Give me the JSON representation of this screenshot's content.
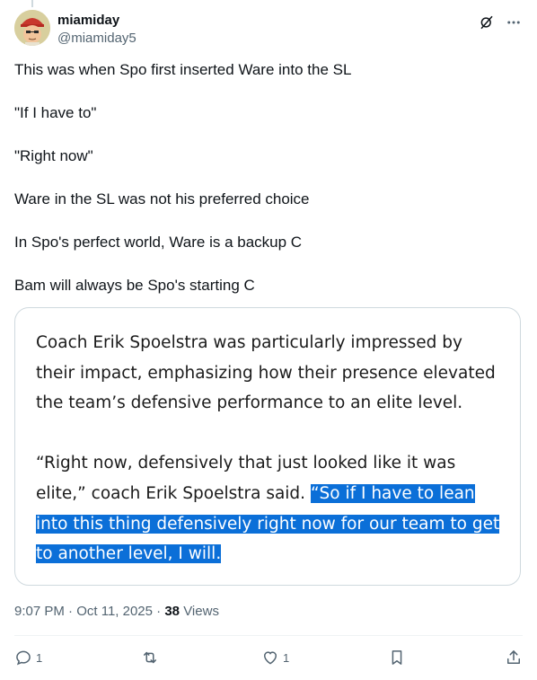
{
  "author": {
    "display_name": "miamiday",
    "handle": "@miamiday5"
  },
  "tweet": {
    "paragraphs": [
      "This was when Spo first inserted Ware into the SL",
      "\"If I have to\"",
      "\"Right now\"",
      "Ware in the SL was not his preferred choice",
      "In Spo's perfect world, Ware is a backup C",
      "Bam will always be Spo's starting C"
    ]
  },
  "quote": {
    "paragraph1": "Coach Erik Spoelstra was particularly impressed by their impact, emphasizing how their presence elevated the team’s defensive performance to an elite level.",
    "paragraph2_plain": "“Right now, defensively that just looked like it was elite,” coach Erik Spoelstra said. ",
    "paragraph2_highlight": "“So if I have to lean into this thing defensively right now for our team to get to another level, I will."
  },
  "meta": {
    "time": "9:07 PM",
    "separator1": " · ",
    "date": "Oct 11, 2025",
    "separator2": " · ",
    "views_count": "38",
    "views_label": " Views"
  },
  "actions": {
    "reply_count": "1",
    "repost_count": "",
    "like_count": "1"
  },
  "icons": {
    "header": [
      "grok-icon",
      "more-icon"
    ],
    "footer": [
      "reply-icon",
      "repost-icon",
      "like-icon",
      "bookmark-icon",
      "share-icon"
    ]
  },
  "colors": {
    "text_primary": "#0f1419",
    "text_secondary": "#536471",
    "highlight": "#0b6fd8",
    "border": "#cfd9de"
  }
}
